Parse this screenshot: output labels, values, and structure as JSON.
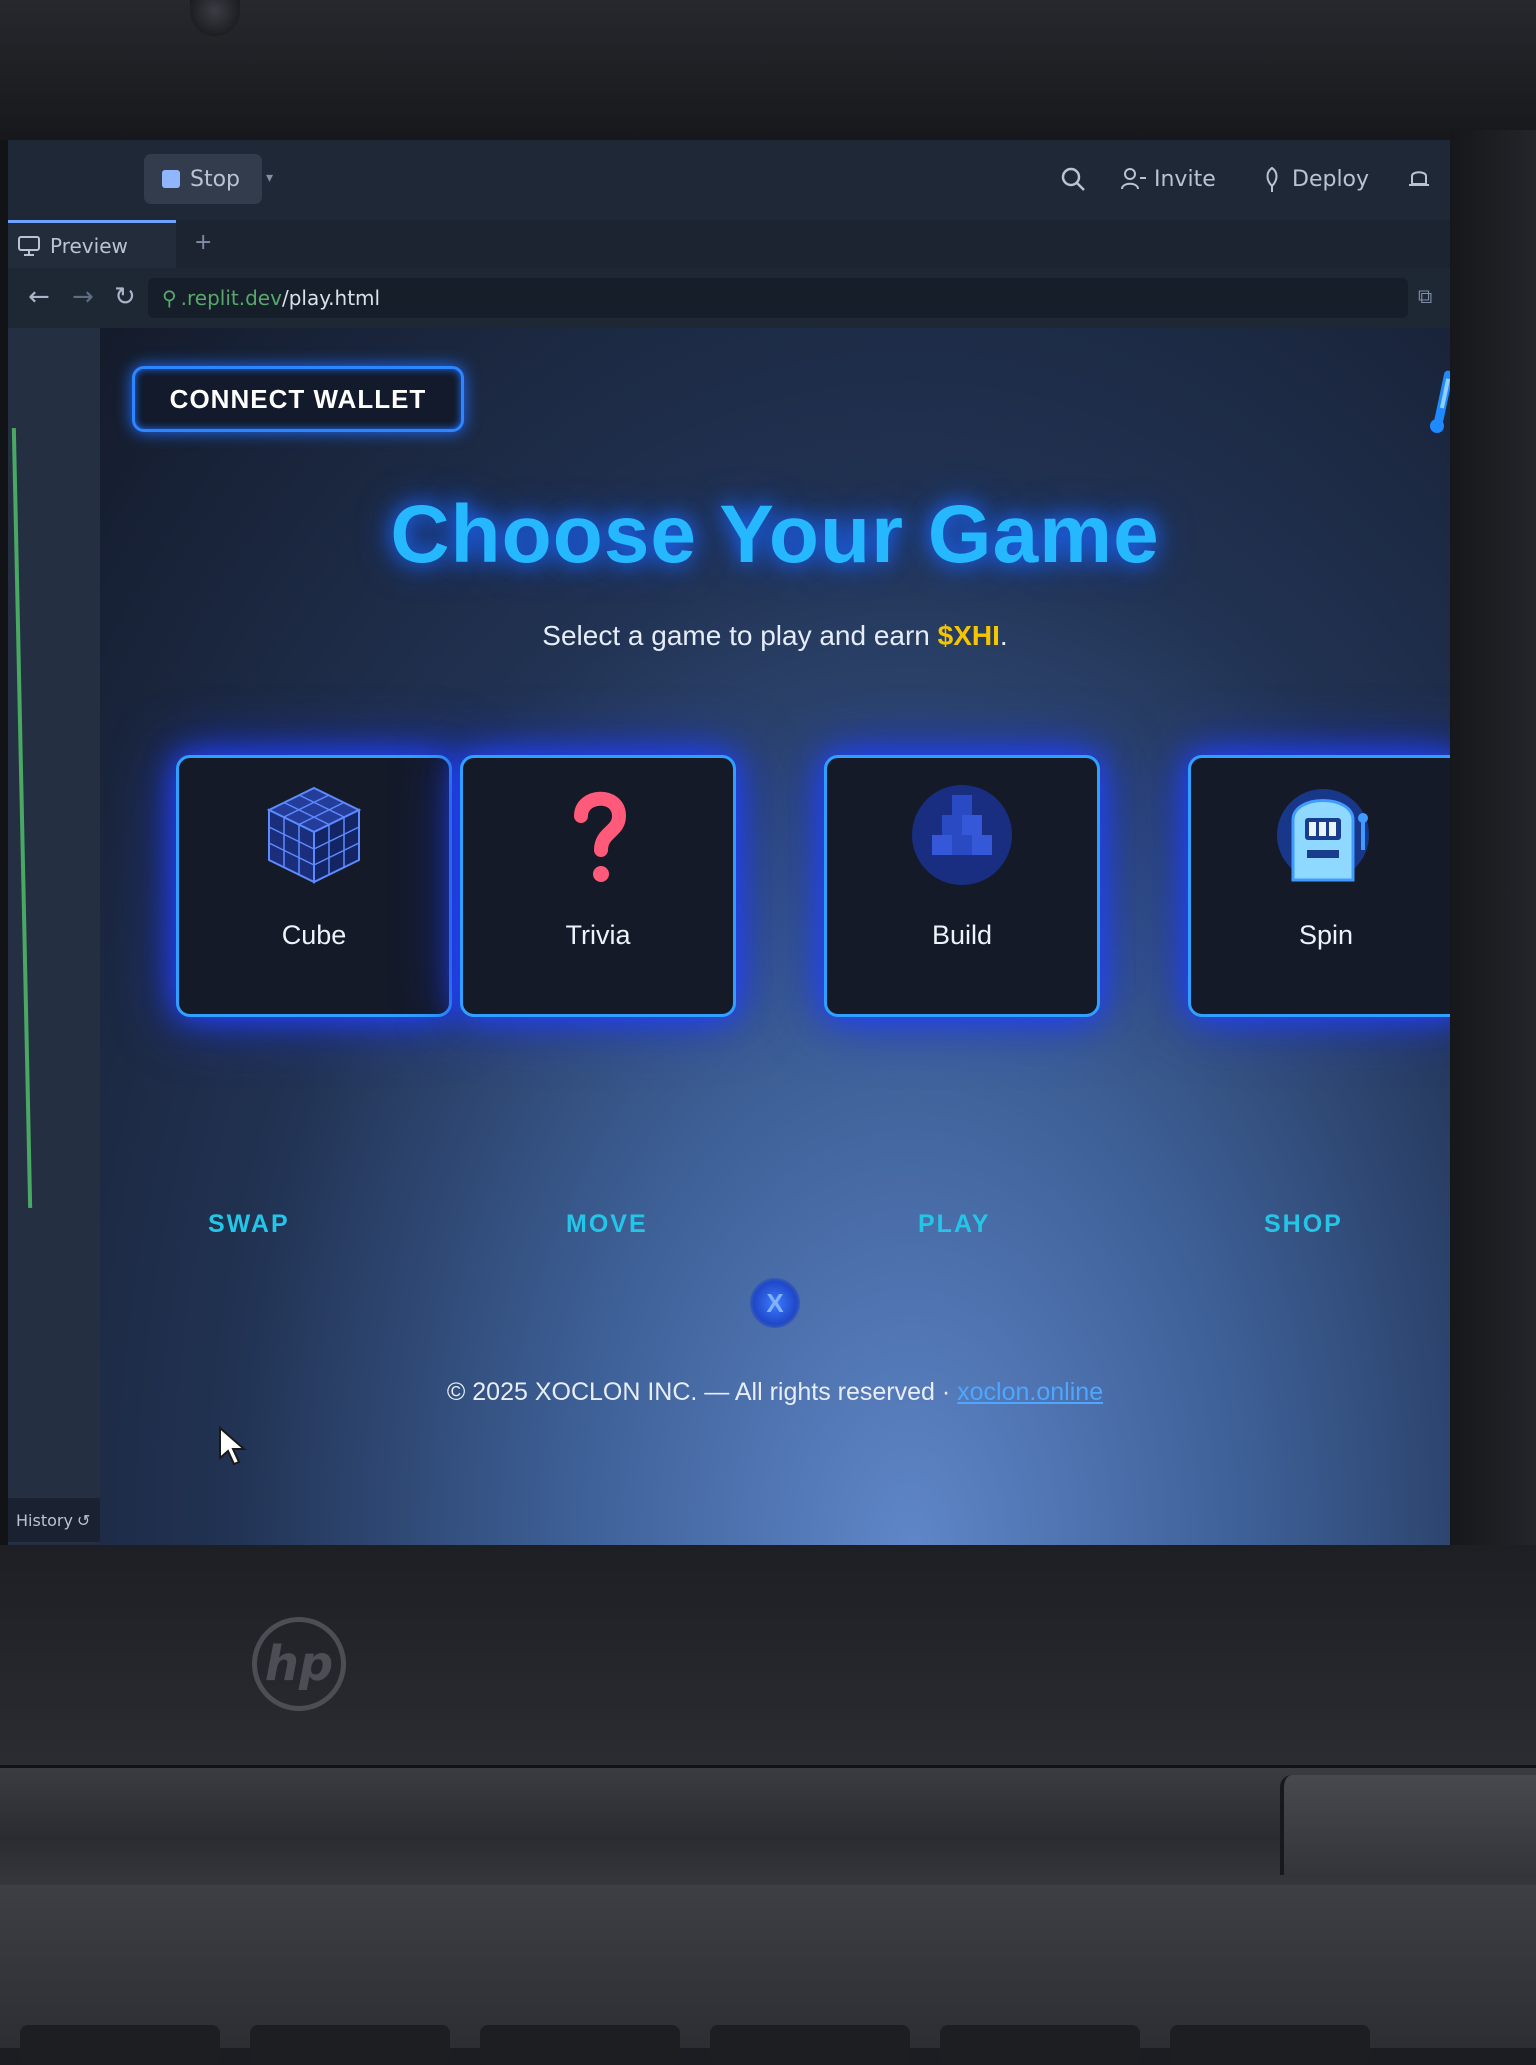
{
  "replit": {
    "stop_label": "Stop",
    "invite_label": "Invite",
    "deploy_label": "Deploy",
    "tab_label": "Preview",
    "url_domain": ".replit.dev",
    "url_path": "/play.html",
    "history_label": "History"
  },
  "page": {
    "connect_wallet_label": "CONNECT WALLET",
    "title": "Choose Your Game",
    "subtitle_prefix": "Select a game to play and earn ",
    "subtitle_coin": "$XHI",
    "subtitle_suffix": ".",
    "games": [
      {
        "label": "Cube",
        "icon": "cube-icon"
      },
      {
        "label": "Trivia",
        "icon": "question-mark-icon"
      },
      {
        "label": "Build",
        "icon": "blocks-icon"
      },
      {
        "label": "Spin",
        "icon": "slot-machine-icon"
      }
    ],
    "actions": [
      "SWAP",
      "MOVE",
      "PLAY",
      "SHOP"
    ],
    "badge_letter": "X",
    "footer_text": "© 2025 XOCLON INC. — All rights reserved · ",
    "footer_link": "xoclon.online"
  },
  "device": {
    "logo": "hp"
  },
  "colors": {
    "accent": "#26b8ff",
    "card_border": "#2fa0ff",
    "coin": "#f7c400",
    "action": "#24c6e8"
  }
}
